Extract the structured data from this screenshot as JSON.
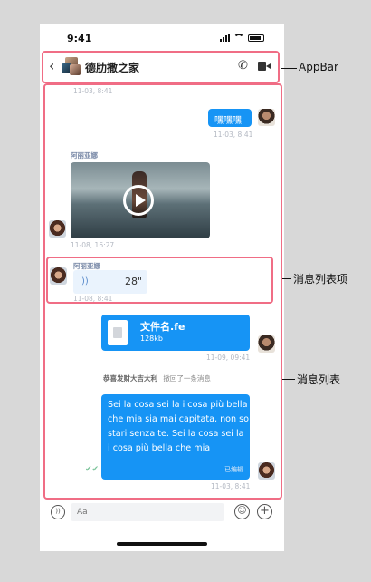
{
  "status": {
    "time": "9:41"
  },
  "appbar": {
    "back_icon": "‹",
    "title": "德肋撒之家",
    "phone_icon": "✆"
  },
  "messages": {
    "ts_top": "11-03, 8:41",
    "self_text": "嘿嘿嘿",
    "self_text_ts": "11-03, 8:41",
    "video_sender": "阿丽亚娜",
    "video_ts": "11-08, 16:27",
    "voice_sender": "阿丽亚娜",
    "voice_wave": "))",
    "voice_duration": "28\"",
    "voice_ts": "11-08, 8:41",
    "file_name": "文件名.fe",
    "file_size": "128kb",
    "file_ts": "11-09, 09:41",
    "notice_actor": "恭喜发财大吉大利",
    "notice_text": "撤回了一条消息",
    "long_text": "Sei la cosa sei la i cosa più bella che mia sia mai capitata, non so stari senza te. Sei la cosa sei la i cosa più bella che mia",
    "long_edited": "已编辑",
    "long_ts": "11-03, 8:41",
    "check_icon": "✔✔"
  },
  "inputbar": {
    "voice_icon": "))",
    "placeholder": "Aa",
    "emoji_icon": "☺",
    "plus_icon": "+"
  },
  "annotations": {
    "appbar": "AppBar",
    "list_item": "消息列表项",
    "list": "消息列表"
  }
}
